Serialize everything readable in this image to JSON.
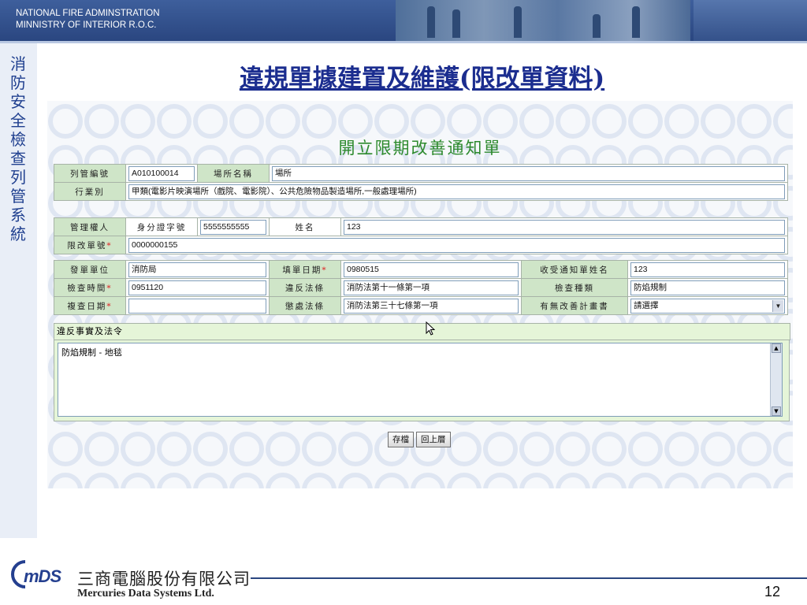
{
  "header": {
    "org_line1": "NATIONAL FIRE ADMINSTRATION",
    "org_line2": "MINNISTRY OF INTERIOR R.O.C."
  },
  "side_title": "消防安全檢查列管系統",
  "slide_title": "違規單據建置及維護(限改單資料)",
  "form": {
    "title": "開立限期改善通知單",
    "row1": {
      "label_a": "列管編號",
      "value_a": "A010100014",
      "label_b": "場所名稱",
      "value_b": "場所"
    },
    "row2": {
      "label": "行業別",
      "value": "甲類(電影片映演場所（戲院、電影院）、公共危險物品製造場所,一般處理場所)"
    },
    "row3": {
      "label_a": "管理權人",
      "label_b": "身分證字號",
      "value_b": "5555555555",
      "label_c": "姓名",
      "value_c": "123"
    },
    "row4": {
      "label": "限改單號",
      "value": "0000000155"
    },
    "row5": {
      "label_a": "發單單位",
      "value_a": "消防局",
      "label_b": "填單日期",
      "value_b": "0980515",
      "label_c": "收受通知單姓名",
      "value_c": "123"
    },
    "row6": {
      "label_a": "檢查時間",
      "value_a": "0951120",
      "label_b": "違反法條",
      "value_b": "消防法第十一條第一項",
      "label_c": "檢查種類",
      "value_c": "防焰規制"
    },
    "row7": {
      "label_a": "複查日期",
      "value_a": "",
      "label_b": "懲處法條",
      "value_b": "消防法第三十七條第一項",
      "label_c": "有無改善計畫書",
      "select_value": "請選擇"
    },
    "required_mark": "*",
    "section_label": "違反事實及法令",
    "facts_text": "防焰規制 - 地毯",
    "save_button": "存檔",
    "back_button": "回上層"
  },
  "footer": {
    "logo_text": "mDS",
    "company_cn": "三商電腦股份有限公司",
    "company_en": "Mercuries Data Systems Ltd.",
    "page_number": "12"
  },
  "colors": {
    "header_blue": "#2a4680",
    "title_blue": "#1b2d8f",
    "form_title_green": "#2d8a2d",
    "label_green": "#cfe5c8",
    "required_red": "#d22"
  }
}
